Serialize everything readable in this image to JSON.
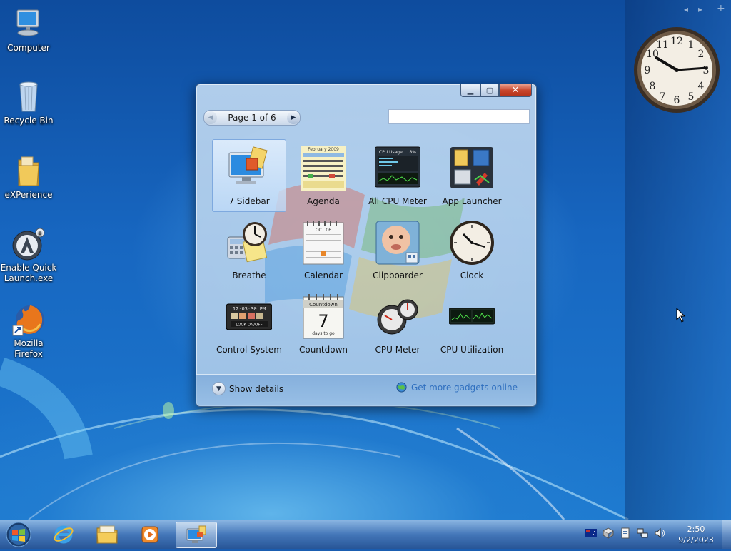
{
  "desktop": {
    "icons": [
      {
        "label": "Computer",
        "icon": "computer-icon"
      },
      {
        "label": "Recycle Bin",
        "icon": "recycle-bin-icon"
      },
      {
        "label": "eXPerience",
        "icon": "folder-icon"
      },
      {
        "label": "Enable Quick Launch.exe",
        "icon": "quick-launch-icon"
      },
      {
        "label": "Mozilla Firefox",
        "icon": "firefox-icon"
      }
    ]
  },
  "sidebar": {
    "prev": "◂",
    "next": "▸",
    "add": "+"
  },
  "gallery": {
    "pager_label": "Page 1 of 6",
    "search_placeholder": "",
    "gadgets": [
      {
        "label": "7 Sidebar",
        "icon": "sidebar-icon",
        "selected": true
      },
      {
        "label": "Agenda",
        "icon": "agenda-calendar-icon"
      },
      {
        "label": "All CPU Meter",
        "icon": "cpu-meter-icon"
      },
      {
        "label": "App Launcher",
        "icon": "app-launcher-icon"
      },
      {
        "label": "Breathe",
        "icon": "breathe-icon"
      },
      {
        "label": "Calendar",
        "icon": "calendar-icon"
      },
      {
        "label": "Clipboarder",
        "icon": "clipboarder-icon"
      },
      {
        "label": "Clock",
        "icon": "clock-icon"
      },
      {
        "label": "Control System",
        "icon": "control-system-icon"
      },
      {
        "label": "Countdown",
        "icon": "countdown-icon"
      },
      {
        "label": "CPU Meter",
        "icon": "cpu-gauge-icon"
      },
      {
        "label": "CPU Utilization",
        "icon": "cpu-utilization-icon"
      }
    ],
    "thumb_text": {
      "agenda_month": "February 2009",
      "cpu_title": "CPU Usage",
      "cpu_percent": "8%",
      "calendar_month": "OCT 06",
      "control_time": "12:03:30 PM",
      "control_lock": "LOCK ON/OFF",
      "countdown_title": "Countdown",
      "countdown_number": "7",
      "countdown_caption": "days to go"
    },
    "show_details": "Show details",
    "get_more": "Get more gadgets online"
  },
  "taskbar": {
    "time": "2:50",
    "date": "9/2/2023"
  }
}
